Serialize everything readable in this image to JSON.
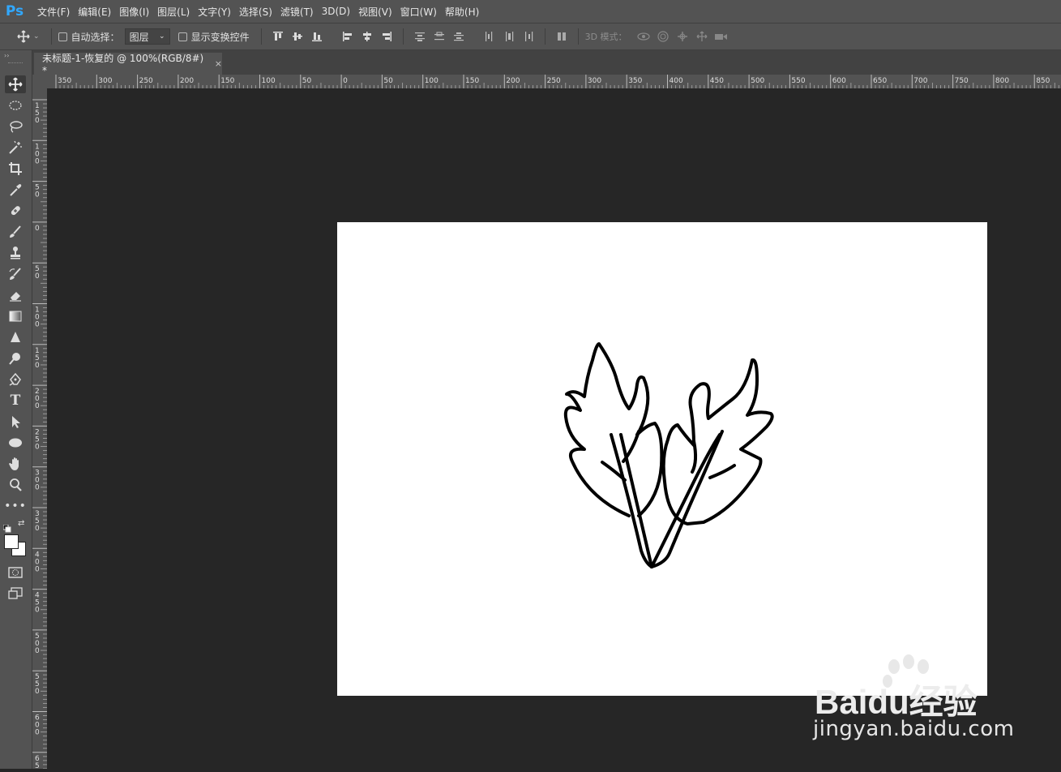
{
  "app": {
    "logo": "Ps"
  },
  "menu": [
    "文件(F)",
    "编辑(E)",
    "图像(I)",
    "图层(L)",
    "文字(Y)",
    "选择(S)",
    "滤镜(T)",
    "3D(D)",
    "视图(V)",
    "窗口(W)",
    "帮助(H)"
  ],
  "options": {
    "auto_select_label": "自动选择：",
    "auto_select_value": "图层",
    "show_transform_label": "显示变换控件",
    "mode_3d_label": "3D 模式："
  },
  "document": {
    "tab_title": "未标题-1-恢复的 @ 100%(RGB/8#) *",
    "close_glyph": "×",
    "background_color": "#ffffff",
    "artwork": "leaf-sprig-line-drawing"
  },
  "rulers": {
    "horizontal_labels": [
      "350",
      "300",
      "250",
      "200",
      "150",
      "100",
      "50",
      "0",
      "50",
      "100",
      "150",
      "200",
      "250",
      "300",
      "350",
      "400",
      "450",
      "500",
      "550",
      "600",
      "650",
      "700",
      "750",
      "800",
      "850"
    ],
    "vertical_labels": [
      "150",
      "100",
      "50",
      "0",
      "50",
      "100",
      "150",
      "200",
      "250",
      "300",
      "350",
      "400",
      "450",
      "500",
      "550",
      "600",
      "650"
    ]
  },
  "tools": [
    "move-tool",
    "marquee-tool",
    "lasso-tool",
    "magic-wand-tool",
    "crop-tool",
    "eyedropper-tool",
    "healing-brush-tool",
    "brush-tool",
    "clone-stamp-tool",
    "history-brush-tool",
    "eraser-tool",
    "gradient-tool",
    "blur-tool",
    "dodge-tool",
    "pen-tool",
    "type-tool",
    "path-selection-tool",
    "ellipse-tool",
    "hand-tool",
    "zoom-tool",
    "more-tools"
  ],
  "colors": {
    "foreground": "#ffffff",
    "background": "#ffffff",
    "workspace": "#262626",
    "panel": "#535353",
    "accent": "#31a8ff"
  },
  "watermark": {
    "brand": "Baidu经验",
    "url": "jingyan.baidu.com"
  }
}
